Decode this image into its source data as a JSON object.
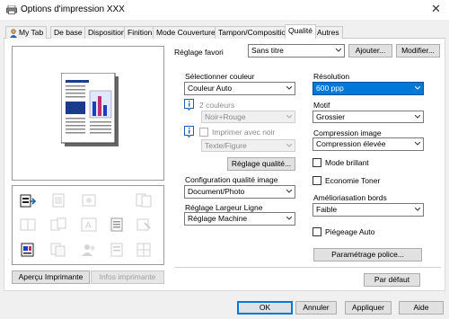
{
  "window": {
    "title": "Options d'impression XXX",
    "close_glyph": "✕"
  },
  "tabs": [
    {
      "label": "My Tab",
      "active": false
    },
    {
      "label": "De base",
      "active": false
    },
    {
      "label": "Disposition",
      "active": false
    },
    {
      "label": "Finition",
      "active": false
    },
    {
      "label": "Mode Couverture",
      "active": false
    },
    {
      "label": "Tampon/Composition",
      "active": false
    },
    {
      "label": "Qualité",
      "active": true
    },
    {
      "label": "Autres",
      "active": false
    }
  ],
  "favorite": {
    "label": "Réglage favori",
    "value": "Sans titre",
    "add_label": "Ajouter...",
    "modify_label": "Modifier..."
  },
  "color": {
    "label": "Sélectionner couleur",
    "value": "Couleur Auto",
    "two_colors_label": "2 couleurs",
    "two_colors_value": "Noir+Rouge",
    "print_black_label": "Imprimer avec noir",
    "print_black_value": "Texte/Figure",
    "quality_button": "Réglage qualité..."
  },
  "quality_config": {
    "label": "Configuration qualité image",
    "value": "Document/Photo"
  },
  "line_width": {
    "label": "Réglage Largeur Ligne",
    "value": "Réglage Machine"
  },
  "resolution": {
    "label": "Résolution",
    "value": "600 ppp"
  },
  "pattern": {
    "label": "Motif",
    "value": "Grossier"
  },
  "compression": {
    "label": "Compression image",
    "value": "Compression élevée"
  },
  "glossy": {
    "label": "Mode brillant",
    "checked": false
  },
  "toner_save": {
    "label": "Economie Toner",
    "checked": false
  },
  "edge": {
    "label": "Amélioriasation bords",
    "value": "Faible"
  },
  "trapping": {
    "label": "Piégeage Auto",
    "checked": false
  },
  "font_settings_button": "Paramétrage police...",
  "preview": {
    "apercu_button": "Aperçu Imprimante",
    "infos_button": "Infos imprimante"
  },
  "default_button": "Par défaut",
  "dialog_buttons": {
    "ok": "OK",
    "cancel": "Annuler",
    "apply": "Appliquer",
    "help": "Aide"
  },
  "colors": {
    "accent": "#0078d7",
    "selected_bg": "#0078d7",
    "info_icon": "#1a5fb4"
  }
}
